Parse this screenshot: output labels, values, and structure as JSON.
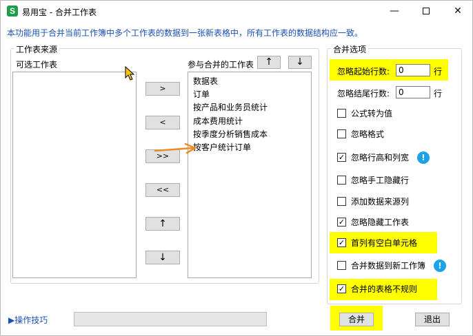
{
  "titlebar": {
    "app_icon_letter": "S",
    "title": "易用宝 - 合并工作表",
    "min_glyph": "—",
    "close_glyph": "✕"
  },
  "description": "本功能用于合并当前工作簿中多个工作表的数据到一张新表格中，所有工作表的数据结构应一致。",
  "source_group": {
    "legend": "工作表来源",
    "available_label": "可选工作表",
    "selected_label": "参与合并的工作表",
    "move_up": "↑",
    "move_down": "↓",
    "available_items": [],
    "selected_items": [
      "数据表",
      "订单",
      "按产品和业务员统计",
      "成本费用统计",
      "按季度分析销售成本",
      "按客户统计订单"
    ]
  },
  "transfer_buttons": {
    "add": ">",
    "remove": "<",
    "add_all": ">>",
    "remove_all": "<<",
    "up": "↑",
    "down": "↓"
  },
  "options_group": {
    "legend": "合并选项",
    "skip_start_rows_label": "忽略起始行数:",
    "skip_start_rows_value": "0",
    "skip_end_rows_label": "忽略结尾行数:",
    "skip_end_rows_value": "0",
    "row_unit": "行",
    "options": [
      {
        "label": "公式转为值",
        "checked": false,
        "mark": ""
      },
      {
        "label": "忽略格式",
        "checked": false,
        "mark": ""
      },
      {
        "label": "忽略行高和列宽",
        "checked": true,
        "mark": "✓"
      },
      {
        "label": "忽略手工隐藏行",
        "checked": false,
        "mark": ""
      },
      {
        "label": "添加数据来源列",
        "checked": false,
        "mark": ""
      },
      {
        "label": "忽略隐藏工作表",
        "checked": true,
        "mark": "✓"
      },
      {
        "label": "首列有空白单元格",
        "checked": true,
        "mark": "✓"
      },
      {
        "label": "合并数据到新工作簿",
        "checked": false,
        "mark": ""
      },
      {
        "label": "合并的表格不规则",
        "checked": true,
        "mark": "✓"
      }
    ],
    "info_glyph": "!"
  },
  "footer": {
    "tips_label": "▶操作技巧",
    "merge_button": "合并",
    "exit_button": "退出"
  },
  "colors": {
    "highlight": "#ffff00",
    "link_blue": "#1a4fb3",
    "info_blue": "#1aa3e8",
    "arrow_orange": "#f08a24",
    "cursor_yellow": "#f5c518"
  }
}
